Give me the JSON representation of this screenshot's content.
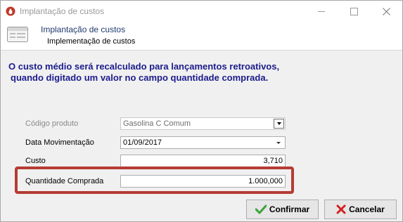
{
  "window": {
    "title": "Implantação de custos"
  },
  "header": {
    "title": "Implantação de custos",
    "subtitle": "Implementação de custos"
  },
  "notice": {
    "line1": "O custo médio será recalculado para lançamentos retroativos,",
    "line2": "quando digitado um valor no campo quantidade comprada."
  },
  "form": {
    "produto": {
      "label": "Código produto",
      "value": "Gasolina C Comum"
    },
    "data": {
      "label": "Data Movimentação",
      "value": "01/09/2017"
    },
    "custo": {
      "label": "Custo",
      "value": "3,710"
    },
    "quantidade": {
      "label": "Quantidade Comprada",
      "value": "1.000,000"
    }
  },
  "buttons": {
    "confirm": "Confirmar",
    "cancel": "Cancelar"
  },
  "colors": {
    "highlight": "#b53c34",
    "notice": "#1c1c8c",
    "confirm_icon": "#3aa43a",
    "cancel_icon": "#d42020"
  }
}
